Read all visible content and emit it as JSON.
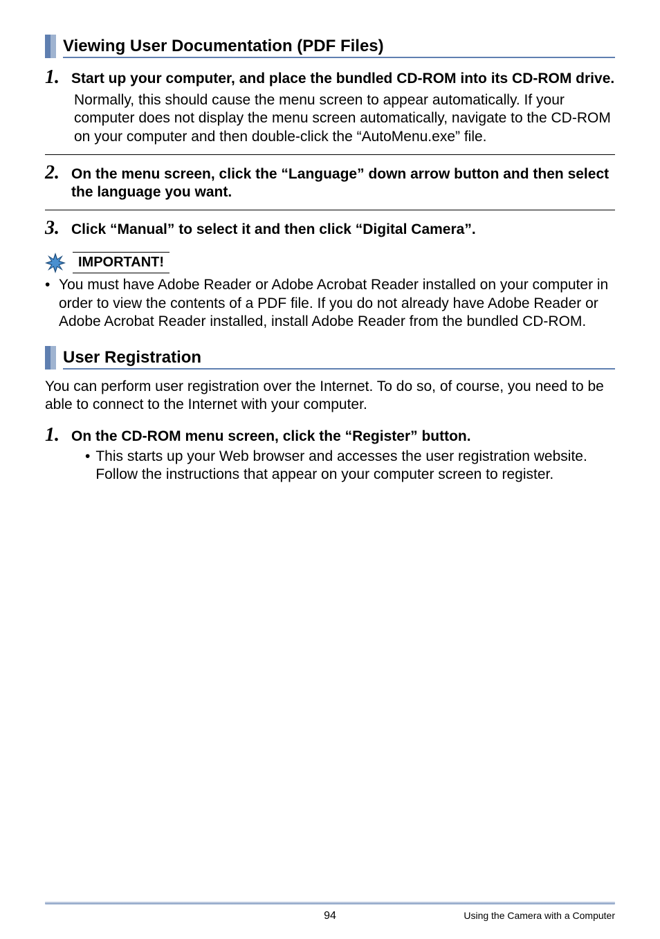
{
  "section1": {
    "heading": "Viewing User Documentation (PDF Files)",
    "steps": [
      {
        "num": "1.",
        "title": "Start up your computer, and place the bundled CD-ROM into its CD-ROM drive.",
        "body": "Normally, this should cause the menu screen to appear automatically. If your computer does not display the menu screen automatically, navigate to the CD-ROM on your computer and then double-click the “AutoMenu.exe” file."
      },
      {
        "num": "2.",
        "title": "On the menu screen, click the “Language” down arrow button and then select the language you want.",
        "body": ""
      },
      {
        "num": "3.",
        "title": "Click “Manual” to select it and then click “Digital Camera”.",
        "body": ""
      }
    ],
    "important": {
      "label": "IMPORTANT!",
      "bullet": "You must have Adobe Reader or Adobe Acrobat Reader installed on your computer in order to view the contents of a PDF file. If you do not already have Adobe Reader or Adobe Acrobat Reader installed, install Adobe Reader from the bundled CD-ROM."
    }
  },
  "section2": {
    "heading": "User Registration",
    "intro": "You can perform user registration over the Internet. To do so, of course, you need to be able to connect to the Internet with your computer.",
    "step": {
      "num": "1.",
      "title": "On the CD-ROM menu screen, click the “Register” button.",
      "sub": "This starts up your Web browser and accesses the user registration website. Follow the instructions that appear on your computer screen to register."
    }
  },
  "footer": {
    "page": "94",
    "chapter": "Using the Camera with a Computer"
  }
}
